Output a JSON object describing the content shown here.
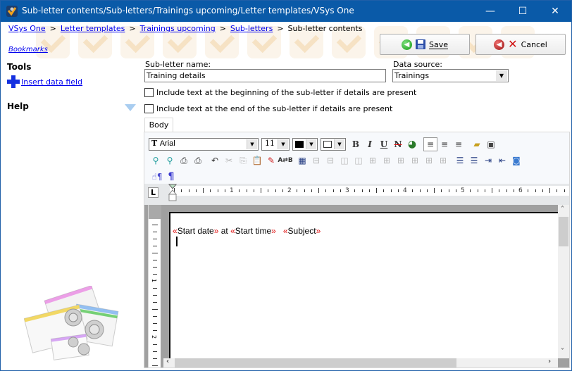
{
  "window": {
    "title": "Sub-letter contents/Sub-letters/Trainings upcoming/Letter templates/VSys One",
    "controls": {
      "minimize": "—",
      "maximize": "☐",
      "close": "✕"
    }
  },
  "breadcrumb": {
    "links": [
      "VSys One",
      "Letter templates",
      "Trainings upcoming",
      "Sub-letters"
    ],
    "current": "Sub-letter contents",
    "separator": ">"
  },
  "bookmarks_label": "Bookmarks",
  "actions": {
    "save": "Save",
    "cancel": "Cancel"
  },
  "sidebar": {
    "tools_heading": "Tools",
    "insert_data_field": "Insert data field",
    "help_heading": "Help"
  },
  "form": {
    "name_label": "Sub-letter name:",
    "name_value": "Training details",
    "datasource_label": "Data source:",
    "datasource_value": "Trainings",
    "checkbox_begin": {
      "label": "Include text at the beginning of the sub-letter if details are present",
      "checked": false
    },
    "checkbox_end": {
      "label": "Include text at the end of the sub-letter if details are present",
      "checked": false
    }
  },
  "tabs": [
    {
      "label": "Body",
      "active": true
    }
  ],
  "editor": {
    "font": "Arial",
    "size": "11",
    "ruler_numbers": [
      "1",
      "2",
      "3",
      "4",
      "5",
      "6"
    ],
    "vruler_numbers": [
      "1",
      "2"
    ],
    "content": {
      "field1": "Start date",
      "between1": " at ",
      "field2": "Start time",
      "between2": "   ",
      "field3": "Subject",
      "open_quote": "«",
      "close_quote": "»"
    },
    "toolbar_row1": [
      "bold",
      "italic",
      "underline",
      "strikethrough",
      "hyperlink",
      "align-left",
      "align-center",
      "align-right",
      "open",
      "save"
    ],
    "toolbar_row2": [
      "zoom-out",
      "zoom-in",
      "print",
      "print-preview",
      "undo",
      "cut",
      "copy",
      "paste",
      "format-painter",
      "find-replace",
      "insert-table",
      "merge-cells",
      "split-cells",
      "insert-column-left",
      "insert-column-right",
      "cell-borders-all",
      "cell-borders-grid",
      "cell-borders-outer",
      "cell-borders-inner",
      "cell-borders-none",
      "cell-borders-top",
      "bullet-list",
      "numbered-list",
      "increase-indent",
      "decrease-indent",
      "preview"
    ],
    "toolbar_row3": [
      "show-formatting-hand",
      "show-paragraph-marks"
    ]
  },
  "colors": {
    "titlebar": "#0a5aa8",
    "link": "#0000ee",
    "field_marker": "#e01010",
    "accent_plus": "#1430e0"
  }
}
